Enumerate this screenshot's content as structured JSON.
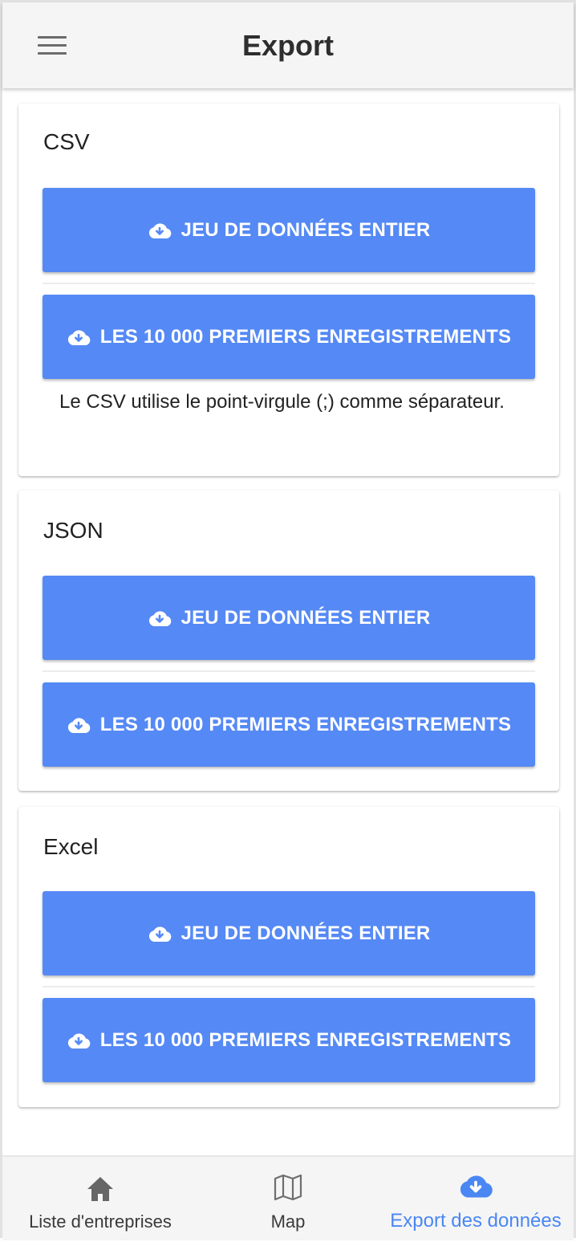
{
  "header": {
    "title": "Export"
  },
  "sections": [
    {
      "title": "CSV",
      "buttons": [
        "JEU DE DONNÉES ENTIER",
        "LES 10 000 PREMIERS ENREGISTREMENTS"
      ],
      "note": "Le CSV utilise le point-virgule (;) comme séparateur."
    },
    {
      "title": "JSON",
      "buttons": [
        "JEU DE DONNÉES ENTIER",
        "LES 10 000 PREMIERS ENREGISTREMENTS"
      ]
    },
    {
      "title": "Excel",
      "buttons": [
        "JEU DE DONNÉES ENTIER",
        "LES 10 000 PREMIERS ENREGISTREMENTS"
      ]
    }
  ],
  "bottom_nav": {
    "items": [
      {
        "label": "Liste d'entreprises",
        "icon": "home-icon"
      },
      {
        "label": "Map",
        "icon": "map-icon"
      },
      {
        "label": "Export des données",
        "icon": "cloud-download-icon",
        "active": true
      }
    ]
  },
  "colors": {
    "button": "#5589f5",
    "active_nav": "#4a87f3",
    "app_bar": "#f5f5f5"
  }
}
